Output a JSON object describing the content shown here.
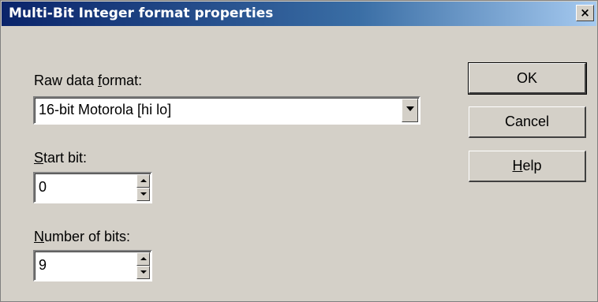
{
  "window": {
    "title": "Multi-Bit Integer format properties",
    "close_glyph": "×"
  },
  "raw_format": {
    "label_pre": "Raw data ",
    "label_u": "f",
    "label_post": "ormat:",
    "selected": "16-bit Motorola  [hi lo]"
  },
  "start_bit": {
    "label_u": "S",
    "label_post": "tart bit:",
    "value": "0"
  },
  "num_bits": {
    "label_u": "N",
    "label_post": "umber of bits:",
    "value": "9"
  },
  "buttons": {
    "ok": "OK",
    "cancel": "Cancel",
    "help_u": "H",
    "help_post": "elp"
  }
}
